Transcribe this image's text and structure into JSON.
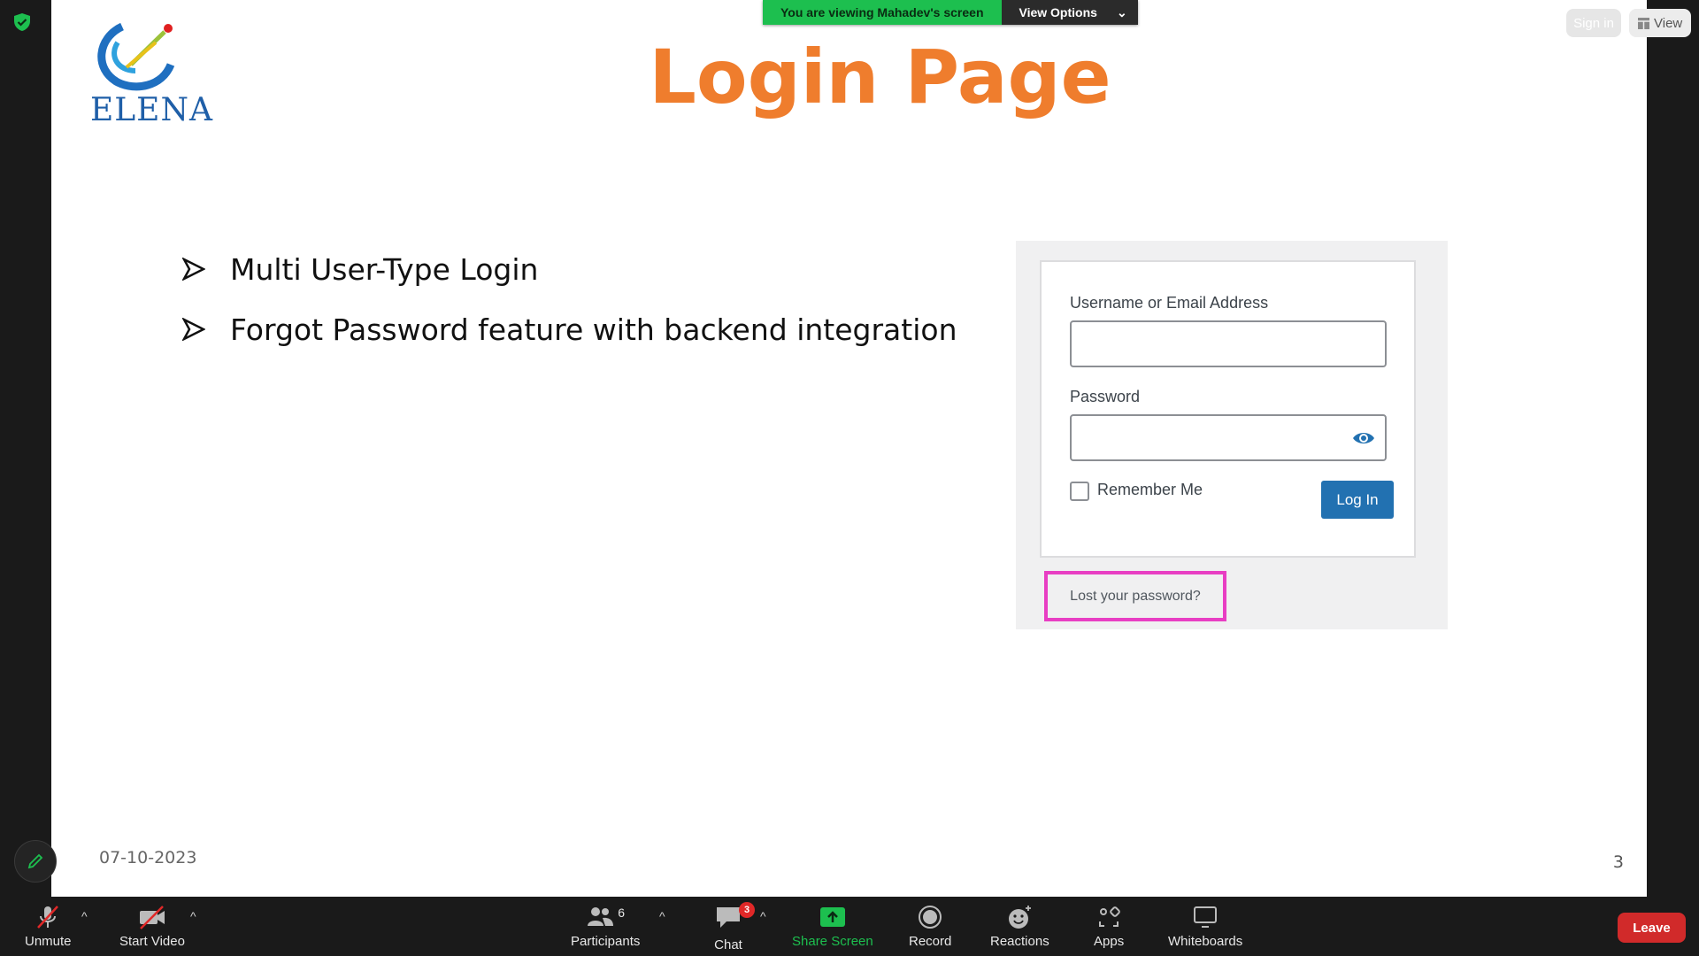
{
  "banner": {
    "viewing_text": "You are viewing Mahadev's screen",
    "view_options_label": "View Options"
  },
  "top_right": {
    "sign_in_label": "Sign in",
    "view_label": "View"
  },
  "slide": {
    "logo_text": "ELENA",
    "title": "Login Page",
    "bullets": [
      "Multi User-Type Login",
      "Forgot Password feature with backend integration"
    ],
    "date": "07-10-2023",
    "page_number": "3",
    "login_form": {
      "username_label": "Username or Email Address",
      "password_label": "Password",
      "remember_label": "Remember Me",
      "login_button": "Log In",
      "lost_password_link": "Lost your password?",
      "highlight_color": "#e83ec3",
      "button_color": "#2271b1"
    },
    "title_color": "#ef7d2d"
  },
  "toolbar": {
    "unmute": "Unmute",
    "start_video": "Start Video",
    "participants": "Participants",
    "participants_count": "6",
    "chat": "Chat",
    "chat_badge": "3",
    "share_screen": "Share Screen",
    "record": "Record",
    "reactions": "Reactions",
    "apps": "Apps",
    "whiteboards": "Whiteboards",
    "leave": "Leave"
  }
}
